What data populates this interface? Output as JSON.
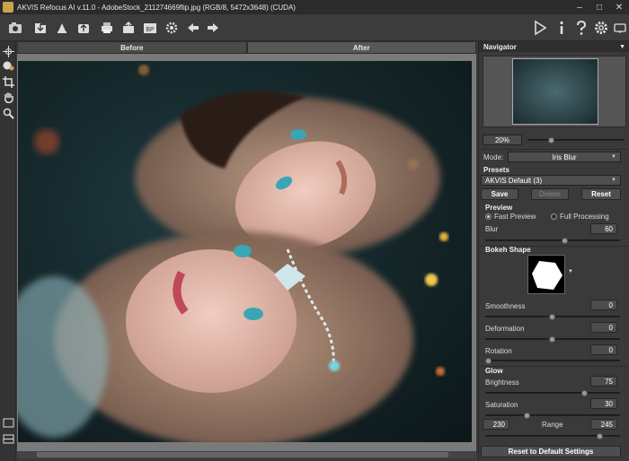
{
  "window": {
    "title": "AKVIS Refocus AI v.11.0 - AdobeStock_211274669flip.jpg (RGB/8, 5472x3648) (CUDA)",
    "minimize": "–",
    "maximize": "□",
    "close": "✕"
  },
  "tabs": [
    {
      "label": "Before"
    },
    {
      "label": "After"
    }
  ],
  "navigator": {
    "title": "Navigator",
    "zoom": "20%"
  },
  "mode": {
    "label": "Mode:",
    "value": "Iris Blur"
  },
  "presets": {
    "title": "Presets",
    "value": "AKVIS Default (3)",
    "save": "Save",
    "delete": "Delete",
    "reset": "Reset"
  },
  "preview": {
    "title": "Preview",
    "fast": "Fast Preview",
    "full": "Full Processing",
    "selected": "fast"
  },
  "params": {
    "blur": {
      "label": "Blur",
      "value": "60",
      "fraction": 0.6
    },
    "bokeh_title": "Bokeh Shape",
    "smoothness": {
      "label": "Smoothness",
      "value": "0",
      "fraction": 0.5
    },
    "deformation": {
      "label": "Deformation",
      "value": "0",
      "fraction": 0.5
    },
    "rotation": {
      "label": "Rotation",
      "value": "0",
      "fraction": 0.0
    }
  },
  "glow": {
    "title": "Glow",
    "brightness": {
      "label": "Brightness",
      "value": "75",
      "fraction": 0.75
    },
    "saturation": {
      "label": "Saturation",
      "value": "30",
      "fraction": 0.3
    },
    "range_label": "Range",
    "range_min": "230",
    "range_max": "245"
  },
  "reset_defaults": "Reset to Default Settings",
  "colors": {
    "panel": "#3a3a3a",
    "toolbar": "#3c3c3c",
    "accent": "#c9a44a"
  },
  "toolbar_icons": [
    "open-icon",
    "save-icon",
    "upload-icon",
    "print-icon",
    "share-icon",
    "batch-icon",
    "plugin-icon",
    "settings-gear-icon",
    "back-arrow-icon",
    "forward-arrow-icon",
    "run-icon",
    "info-icon",
    "help-icon",
    "preferences-icon",
    "tooltip-icon"
  ]
}
